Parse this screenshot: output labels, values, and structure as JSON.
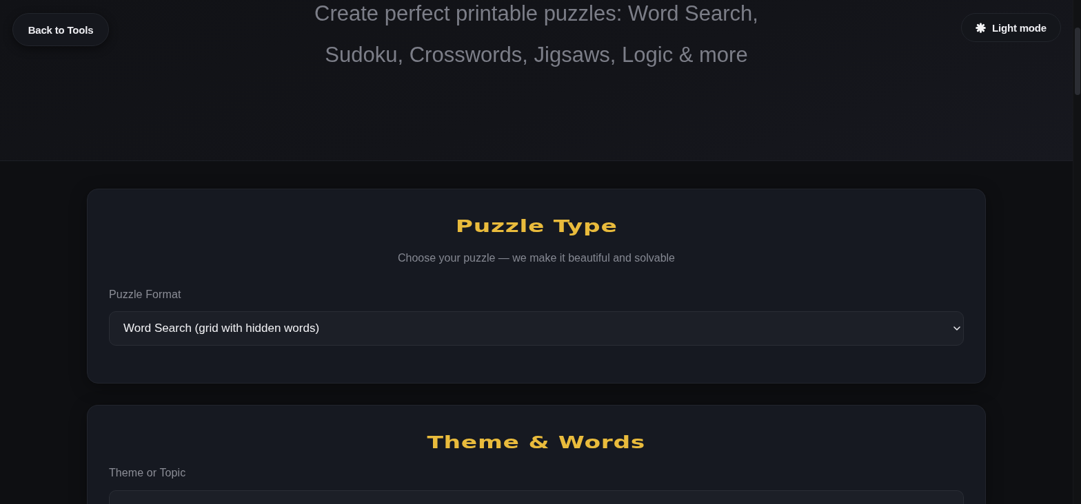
{
  "header": {
    "back_button": "Back to Tools",
    "theme_toggle": {
      "label": "Light mode"
    },
    "tagline": "Create perfect printable puzzles: Word Search, Sudoku, Crosswords, Jigsaws, Logic & more"
  },
  "sections": [
    {
      "title": "Puzzle Type",
      "subtitle": "Choose your puzzle — we make it beautiful and solvable",
      "fields": [
        {
          "kind": "select",
          "label": "Puzzle Format",
          "value": "Word Search (grid with hidden words)"
        }
      ]
    },
    {
      "title": "Theme & Words",
      "fields": [
        {
          "kind": "text",
          "label": "Theme or Topic"
        }
      ]
    }
  ]
}
